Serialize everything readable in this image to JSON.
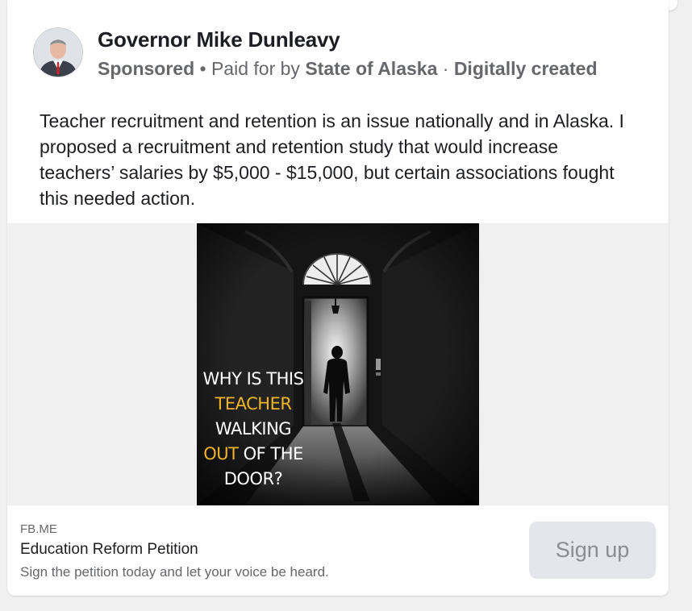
{
  "post": {
    "author": "Governor Mike Dunleavy",
    "sponsored_label": "Sponsored",
    "bullet": "•",
    "paid_for_prefix": "Paid for by",
    "payer": "State of Alaska",
    "separator": "·",
    "digital_label": "Digitally created",
    "text": "Teacher recruitment and retention is an issue nationally and in Alaska. I proposed a recruitment and retention study that would increase teachers’ salaries by $5,000 - $15,000, but certain associations fought this needed action."
  },
  "ad_image": {
    "line1": "WHY IS THIS",
    "line2": "TEACHER",
    "line3": "WALKING",
    "line4_highlight": "OUT",
    "line4_rest": "OF  THE",
    "line5": "DOOR?",
    "highlight_color": "#f0b429",
    "icon": "man-walking-out-door-photo"
  },
  "link": {
    "domain": "FB.ME",
    "title": "Education Reform Petition",
    "description": "Sign the petition today and let your voice be heard.",
    "cta": "Sign up"
  }
}
